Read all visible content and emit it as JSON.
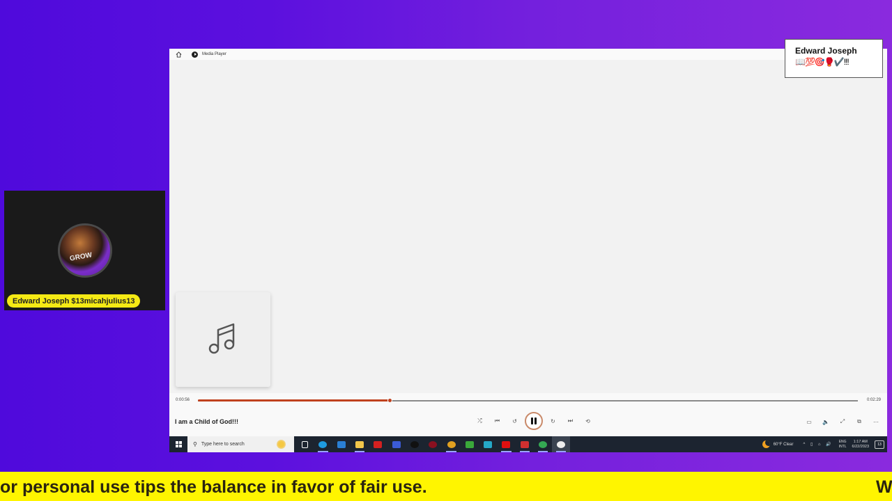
{
  "window": {
    "title": "Media Player",
    "home_icon": "home-icon",
    "app_icon": "media-player-icon"
  },
  "album_art": {
    "icon": "music-note-icon"
  },
  "playback": {
    "current_time": "0:00:56",
    "total_time": "0:02:29",
    "progress_fraction": 0.29,
    "song_title": "I am a Child of God!!!",
    "state": "playing",
    "accent_color": "#c0411e"
  },
  "transport": [
    {
      "name": "shuffle-button",
      "icon": "shuffle-icon",
      "glyph": "⤮"
    },
    {
      "name": "previous-button",
      "icon": "skip-previous-icon",
      "glyph": "⏮"
    },
    {
      "name": "rewind-10-button",
      "icon": "rewind-10-icon",
      "glyph": "↺"
    },
    {
      "name": "forward-30-button",
      "icon": "forward-30-icon",
      "glyph": "↻"
    },
    {
      "name": "next-button",
      "icon": "skip-next-icon",
      "glyph": "⏭"
    },
    {
      "name": "repeat-button",
      "icon": "repeat-off-icon",
      "glyph": "⟲"
    }
  ],
  "right_controls": [
    {
      "name": "captions-button",
      "icon": "captions-icon",
      "glyph": "▭"
    },
    {
      "name": "volume-button",
      "icon": "volume-icon",
      "glyph": "🔈"
    },
    {
      "name": "fullscreen-button",
      "icon": "fullscreen-icon",
      "glyph": "⤢"
    },
    {
      "name": "mini-player-button",
      "icon": "mini-player-icon",
      "glyph": "⧉"
    },
    {
      "name": "more-options-button",
      "icon": "more-icon",
      "glyph": "⋯"
    }
  ],
  "taskbar": {
    "search_placeholder": "Type here to search",
    "apps": [
      {
        "name": "task-view",
        "color": "#ffffff",
        "active": false
      },
      {
        "name": "edge",
        "color": "#1e9be0",
        "active": true
      },
      {
        "name": "mail",
        "color": "#2a7fd4",
        "active": false
      },
      {
        "name": "file-explorer",
        "color": "#f2c64a",
        "active": true
      },
      {
        "name": "app-red",
        "color": "#d42020",
        "active": false
      },
      {
        "name": "facebook",
        "color": "#3b5bd6",
        "active": false
      },
      {
        "name": "tiktok",
        "color": "#111111",
        "active": false
      },
      {
        "name": "opera",
        "color": "#8a1020",
        "active": false
      },
      {
        "name": "chrome",
        "color": "#e0a020",
        "active": true
      },
      {
        "name": "xbox",
        "color": "#3aa83a",
        "active": false
      },
      {
        "name": "app-teal",
        "color": "#25a8c8",
        "active": false
      },
      {
        "name": "youtube",
        "color": "#e01010",
        "active": true
      },
      {
        "name": "app-red-2",
        "color": "#d03030",
        "active": true
      },
      {
        "name": "chrome-2",
        "color": "#34a853",
        "active": true
      },
      {
        "name": "media-player",
        "color": "#eeeeee",
        "active": true
      }
    ],
    "weather": "60°F  Clear",
    "lang_top": "ENG",
    "lang_bottom": "INTL",
    "time": "1:17 AM",
    "date": "6/22/2023",
    "notifications": "13"
  },
  "overlay": {
    "name_card_title": "Edward Joseph",
    "name_card_emojis": "📖💯🎯🥊✔️!!!",
    "camera_name": "Edward Joseph $13micahjulius13",
    "ticker_text": "or personal use tips the balance in favor of fair use.",
    "ticker_next": "W"
  }
}
